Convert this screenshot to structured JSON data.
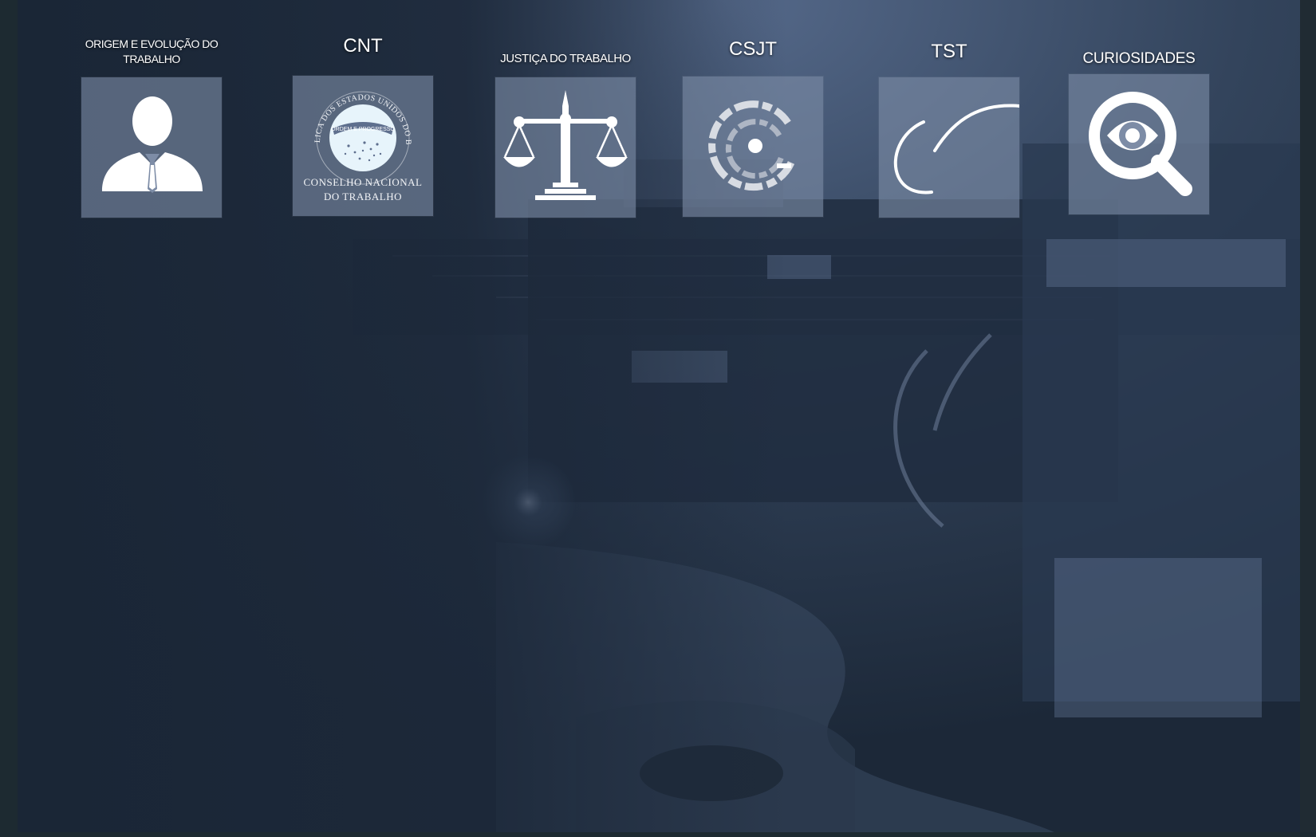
{
  "tiles": [
    {
      "id": "origem",
      "label": "ORIGEM E EVOLUÇÃO DO TRABALHO",
      "icon": "person-suit-icon"
    },
    {
      "id": "cnt",
      "label": "CNT",
      "icon": "brazil-seal-icon",
      "seal": {
        "arc_text": "REPUBLICA DOS ESTADOS UNIDOS DO BRAZIL",
        "band_text": "ORDEM E PROGRESSO",
        "line1": "CONSELHO NACIONAL",
        "line2": "DO TRABALHO"
      }
    },
    {
      "id": "justica",
      "label": "JUSTIÇA DO TRABALHO",
      "icon": "scales-icon"
    },
    {
      "id": "csjt",
      "label": "CSJT",
      "icon": "csjt-logo-icon"
    },
    {
      "id": "tst",
      "label": "TST",
      "icon": "tst-logo-icon"
    },
    {
      "id": "curiosidades",
      "label": "CURIOSIDADES",
      "icon": "magnifier-eye-icon"
    }
  ],
  "theme": {
    "tile_color": "#7d8ca6",
    "background": "#1b2635",
    "text": "#ffffff"
  }
}
